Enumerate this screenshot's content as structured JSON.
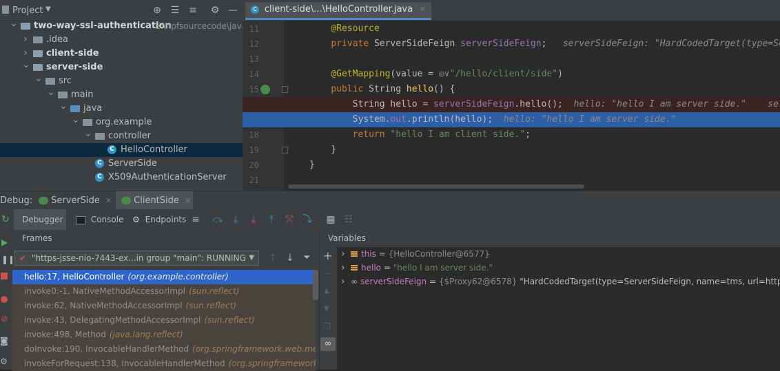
{
  "project": {
    "title": "Project",
    "root_name": "two-way-ssl-authentication",
    "root_path": "E:\\npfsourcecode\\java\\sc",
    "tree": [
      {
        "label": "two-way-ssl-authentication",
        "level": 0,
        "icon": "module-folder",
        "arrow": "down",
        "bold": true
      },
      {
        "label": ".idea",
        "level": 1,
        "icon": "folder",
        "arrow": "right",
        "bold": false
      },
      {
        "label": "client-side",
        "level": 1,
        "icon": "module-folder",
        "arrow": "right",
        "bold": true
      },
      {
        "label": "server-side",
        "level": 1,
        "icon": "module-folder",
        "arrow": "down",
        "bold": true
      },
      {
        "label": "src",
        "level": 2,
        "icon": "folder",
        "arrow": "down",
        "bold": false
      },
      {
        "label": "main",
        "level": 3,
        "icon": "folder",
        "arrow": "down",
        "bold": false
      },
      {
        "label": "java",
        "level": 4,
        "icon": "source-folder",
        "arrow": "down",
        "bold": false
      },
      {
        "label": "org.example",
        "level": 5,
        "icon": "package",
        "arrow": "down",
        "bold": false
      },
      {
        "label": "controller",
        "level": 6,
        "icon": "package",
        "arrow": "down",
        "bold": false
      },
      {
        "label": "HelloController",
        "level": 7,
        "icon": "class",
        "arrow": "",
        "bold": false,
        "selected": true
      },
      {
        "label": "ServerSide",
        "level": 6,
        "icon": "spring-class",
        "arrow": "",
        "bold": false
      },
      {
        "label": "X509AuthenticationServer",
        "level": 6,
        "icon": "class",
        "arrow": "",
        "bold": false
      }
    ]
  },
  "editor": {
    "tab_label": "client-side\\...\\HelloController.java",
    "lines": [
      {
        "n": "11",
        "parts": [
          {
            "t": "    "
          },
          {
            "t": "@Resource",
            "c": "ann"
          }
        ]
      },
      {
        "n": "12",
        "parts": [
          {
            "t": "    "
          },
          {
            "t": "private ",
            "c": "kw"
          },
          {
            "t": "ServerSideFeign "
          },
          {
            "t": "serverSideFeign",
            "c": "fld"
          },
          {
            "t": ";  "
          },
          {
            "t": " serverSideFeign: \"HardCodedTarget(type=Serv",
            "c": "hint"
          }
        ]
      },
      {
        "n": "13",
        "parts": []
      },
      {
        "n": "14",
        "parts": [
          {
            "t": "    "
          },
          {
            "t": "@GetMapping",
            "c": "ann"
          },
          {
            "t": "(value = "
          },
          {
            "t": "◎∨",
            "c": "hint"
          },
          {
            "t": "\"/hello/client/side\"",
            "c": "str"
          },
          {
            "t": ")"
          }
        ]
      },
      {
        "n": "15",
        "parts": [
          {
            "t": "    "
          },
          {
            "t": "public ",
            "c": "kw"
          },
          {
            "t": "String "
          },
          {
            "t": "hello",
            "c": "meth"
          },
          {
            "t": "() {"
          }
        ]
      },
      {
        "n": "16",
        "parts": [
          {
            "t": "        String hello = "
          },
          {
            "t": "serverSideFeign",
            "c": "fld"
          },
          {
            "t": ".hello();"
          },
          {
            "t": "  hello: \"hello I am server side.\"    serv",
            "c": "hint"
          }
        ],
        "highlight": "red"
      },
      {
        "n": "17",
        "parts": [
          {
            "t": "        System."
          },
          {
            "t": "out",
            "c": "fld"
          },
          {
            "t": ".println(hello);"
          },
          {
            "t": "  hello: \"hello I am server side.\"",
            "c": "hint"
          }
        ],
        "highlight": "blue"
      },
      {
        "n": "18",
        "parts": [
          {
            "t": "        "
          },
          {
            "t": "return ",
            "c": "kw"
          },
          {
            "t": "\"hello I am client side.\"",
            "c": "str"
          },
          {
            "t": ";"
          }
        ]
      },
      {
        "n": "19",
        "parts": [
          {
            "t": "    }"
          }
        ]
      },
      {
        "n": "20",
        "parts": [
          {
            "t": "}"
          }
        ]
      },
      {
        "n": "21",
        "parts": []
      }
    ]
  },
  "debug": {
    "label": "Debug:",
    "tabs": [
      "ServerSide",
      "ClientSide"
    ],
    "toolbar_tabs": [
      "Debugger",
      "Console",
      "Endpoints"
    ],
    "frames_title": "Frames",
    "variables_title": "Variables",
    "thread": "\"https-jsse-nio-7443-ex...in group \"main\": RUNNING",
    "frames": [
      {
        "method": "hello:17, HelloController",
        "pkg": "(org.example.controller)",
        "selected": true
      },
      {
        "method": "invoke0:-1, NativeMethodAccessorImpl",
        "pkg": "(sun.reflect)"
      },
      {
        "method": "invoke:62, NativeMethodAccessorImpl",
        "pkg": "(sun.reflect)"
      },
      {
        "method": "invoke:43, DelegatingMethodAccessorImpl",
        "pkg": "(sun.reflect)"
      },
      {
        "method": "invoke:498, Method",
        "pkg": "(java.lang.reflect)"
      },
      {
        "method": "doInvoke:190, InvocableHandlerMethod",
        "pkg": "(org.springframework.web.meth"
      },
      {
        "method": "invokeForRequest:138, InvocableHandlerMethod",
        "pkg": "(org.springframework.w"
      }
    ],
    "variables": [
      {
        "name": "this",
        "eq": " = ",
        "type": "{HelloController@6577}",
        "value": ""
      },
      {
        "name": "hello",
        "eq": " = ",
        "type": "",
        "value": "\"hello I am server side.\""
      },
      {
        "name": "serverSideFeign",
        "eq": " = ",
        "type": "{$Proxy62@6578}",
        "value": " \"HardCodedTarget(type=ServerSideFeign, name=tms, url=https://s"
      }
    ]
  }
}
